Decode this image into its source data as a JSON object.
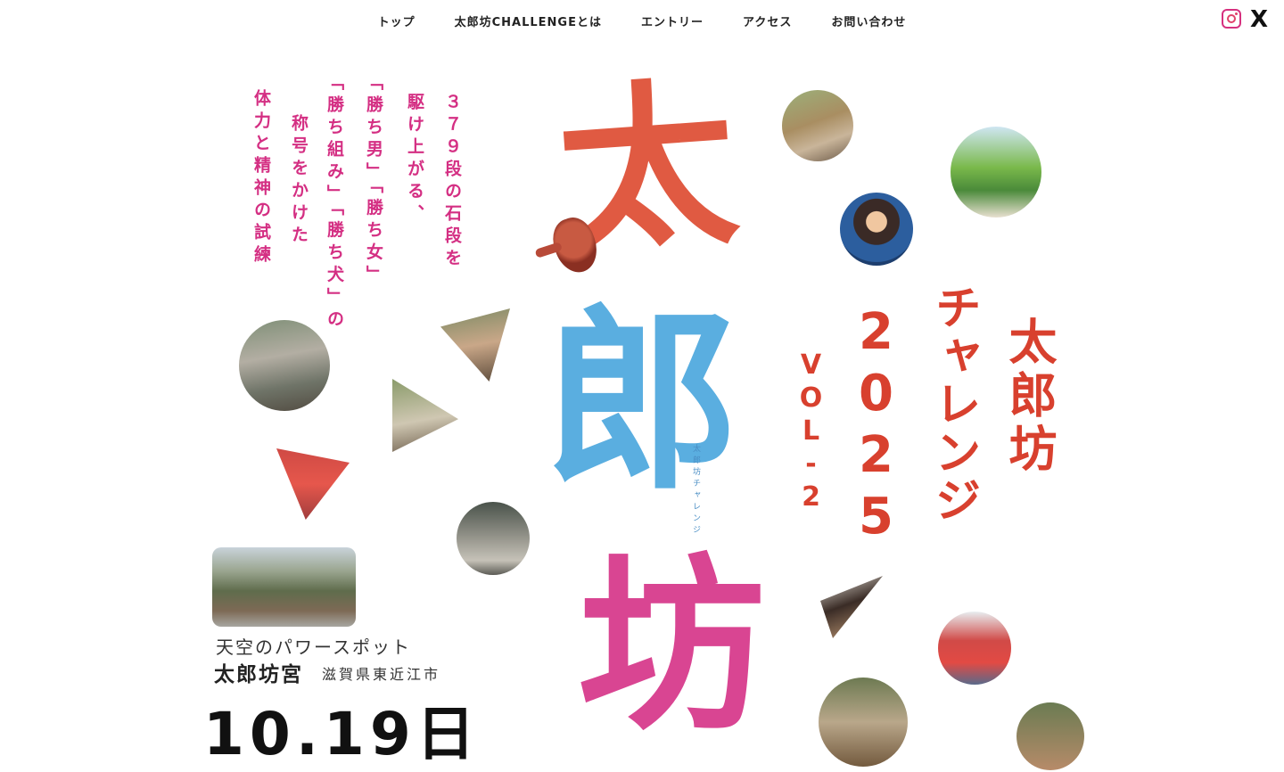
{
  "nav": {
    "items": [
      {
        "label": "トップ"
      },
      {
        "label": "太郎坊CHALLENGEとは"
      },
      {
        "label": "エントリー"
      },
      {
        "label": "アクセス"
      },
      {
        "label": "お問い合わせ"
      }
    ]
  },
  "social": {
    "instagram_icon": "instagram-icon",
    "x_icon": "X"
  },
  "tagline_vertical": [
    "３７９段の石段を",
    "駆け上がる、",
    "「勝ち男」「勝ち女」",
    "「勝ち組み」「勝ち犬」の",
    "称号をかけた",
    "体力と精神の試練"
  ],
  "logo": {
    "char1": "太",
    "char2": "郎",
    "char3": "坊",
    "small_vertical": "太郎坊チャレンジ"
  },
  "event_title": {
    "line1": "太郎坊",
    "line2": "チャレンジ",
    "year": "2025",
    "vol": "VOL-2"
  },
  "venue": {
    "catch": "天空のパワースポット",
    "name": "太郎坊宮",
    "location": "滋賀県東近江市",
    "date_partial": "10.19日"
  },
  "colors": {
    "pink": "#d42f83",
    "red": "#d8402e",
    "blue": "#5aaee0",
    "magenta": "#d94592"
  }
}
